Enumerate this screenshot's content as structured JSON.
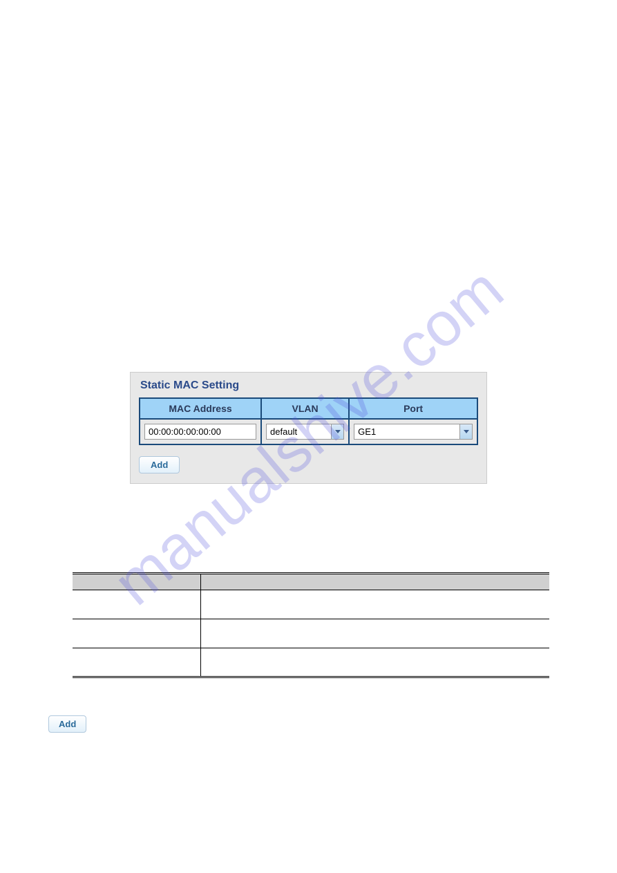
{
  "watermark": "manualshive.com",
  "panel": {
    "title": "Static MAC Setting",
    "headers": {
      "mac": "MAC Address",
      "vlan": "VLAN",
      "port": "Port"
    },
    "inputs": {
      "mac_value": "00:00:00:00:00:00",
      "vlan_value": "default",
      "port_value": "GE1"
    },
    "add_button": "Add"
  },
  "standalone_add": "Add"
}
